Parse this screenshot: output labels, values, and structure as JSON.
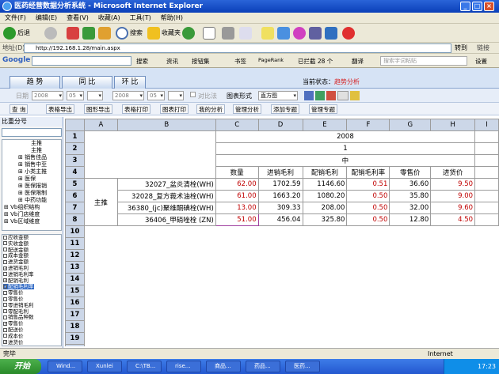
{
  "window": {
    "title": "医药经营数据分析系统 - Microsoft Internet Explorer"
  },
  "menu": [
    "文件(F)",
    "编辑(E)",
    "查看(V)",
    "收藏(A)",
    "工具(T)",
    "帮助(H)"
  ],
  "toolbar": {
    "back": "后退",
    "search": "搜索",
    "favorites": "收藏夹"
  },
  "address": {
    "label": "地址(D)",
    "url": "http://192.168.1.28/main.aspx",
    "go": "转到",
    "links": "链接"
  },
  "googlebar": {
    "brand": "Google",
    "search": "搜索",
    "news": "资讯",
    "bookmarks": "按钮集",
    "books": "书签",
    "pagerank": "PageRank",
    "blocked": "已拦截 28 个",
    "translate": "翻译",
    "query_placeholder": "搜索字词粘贴",
    "settings": "设置"
  },
  "tabs": [
    "趋 势",
    "同 比",
    "环 比"
  ],
  "state": {
    "label": "当前状态：",
    "value": "趋势分析"
  },
  "filter": {
    "date": "日期",
    "y1": "2008",
    "m1": "05",
    "y2": "2008",
    "m2": "05",
    "compare": "对比法",
    "chart_form_label": "图表形式",
    "chart_form": "直方图"
  },
  "actions": [
    "查 询",
    "表格导出",
    "图形导出",
    "表格打印",
    "图表打印",
    "我的分析",
    "管理分析",
    "添加专题",
    "管理专题"
  ],
  "sidebar": {
    "head": "比重分号",
    "tree": [
      "主推",
      "主推",
      "销售佳品",
      "销售中至",
      "小类主推",
      "医保",
      "医保报销",
      "医保限制",
      "中药功能",
      "Vb组织结构",
      "Vb门店维度",
      "Vb区域维度"
    ],
    "list": [
      {
        "t": "应收金额",
        "c": false
      },
      {
        "t": "实收金额",
        "c": false
      },
      {
        "t": "配送金额",
        "c": false
      },
      {
        "t": "成本金额",
        "c": false
      },
      {
        "t": "进货金额",
        "c": false
      },
      {
        "t": "进销毛利",
        "c": true
      },
      {
        "t": "进销毛利率",
        "c": false
      },
      {
        "t": "配销毛利",
        "c": true
      },
      {
        "t": "配销毛利率",
        "c": true,
        "hl": true
      },
      {
        "t": "零售价",
        "c": false
      },
      {
        "t": "零售价",
        "c": false
      },
      {
        "t": "零进销毛利",
        "c": false
      },
      {
        "t": "零配毛利",
        "c": false
      },
      {
        "t": "销售品种数",
        "c": false
      },
      {
        "t": "零售价",
        "c": true
      },
      {
        "t": "配送价",
        "c": false
      },
      {
        "t": "成本价",
        "c": false
      },
      {
        "t": "进货价",
        "c": true
      }
    ]
  },
  "grid": {
    "cols": [
      "A",
      "B",
      "C",
      "D",
      "E",
      "F",
      "G",
      "H",
      "I"
    ],
    "year": "2008",
    "month": "1",
    "region": "中",
    "headers": [
      "数量",
      "进销毛利",
      "配销毛利",
      "配销毛利率",
      "零售价",
      "进货价"
    ],
    "group": "主推",
    "rows": [
      {
        "n": "5",
        "name": "32027_盆炎清栓(WH)",
        "v": [
          "62.00",
          "1702.59",
          "1146.60",
          "0.51",
          "36.60",
          "9.50"
        ]
      },
      {
        "n": "6",
        "name": "32028_复方莪术油栓(WH)",
        "v": [
          "61.00",
          "1663.20",
          "1080.20",
          "0.50",
          "35.80",
          "9.00"
        ]
      },
      {
        "n": "7",
        "name": "36380_(jc)聚维酮碘栓(WH)",
        "v": [
          "13.00",
          "309.33",
          "208.00",
          "0.50",
          "32.00",
          "9.60"
        ]
      },
      {
        "n": "8",
        "name": "36406_甲硝唑栓 (ZN)",
        "v": [
          "51.00",
          "456.04",
          "325.80",
          "0.50",
          "12.80",
          "4.50"
        ]
      }
    ],
    "row_numbers": [
      "1",
      "2",
      "3",
      "4",
      "5",
      "6",
      "7",
      "8",
      "9",
      "10",
      "11",
      "12",
      "13",
      "14",
      "15",
      "16",
      "17",
      "18",
      "19",
      "20"
    ]
  },
  "status": {
    "left": "完毕",
    "zone": "Internet"
  },
  "taskbar": {
    "start": "开始",
    "tasks": [
      "Wind...",
      "Xunlei",
      "C:\\TB...",
      "rise...",
      "商品...",
      "药品...",
      "医药..."
    ],
    "time": "17:23"
  }
}
